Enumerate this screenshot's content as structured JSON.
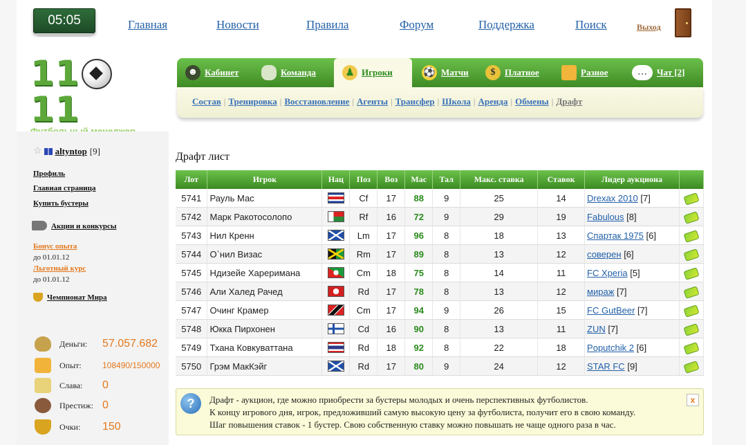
{
  "header": {
    "time": "05:05",
    "nav": [
      "Главная",
      "Новости",
      "Правила",
      "Форум",
      "Поддержка",
      "Поиск"
    ],
    "logout": "Выход"
  },
  "logo": {
    "digits_left": "11",
    "digits_right": "11",
    "subtitle": "Футбольный менеджер"
  },
  "tabs": [
    {
      "label": "Кабинет"
    },
    {
      "label": "Команда"
    },
    {
      "label": "Игроки"
    },
    {
      "label": "Матчи"
    },
    {
      "label": "Платное"
    },
    {
      "label": "Разное"
    },
    {
      "label": "Чат [2]"
    }
  ],
  "subnav": [
    "Состав",
    "Тренировка",
    "Восстановление",
    "Агенты",
    "Трансфер",
    "Школа",
    "Аренда",
    "Обмены",
    "Драфт"
  ],
  "sidebar": {
    "username": "altyntop",
    "level": "[9]",
    "links": [
      "Профиль",
      "Главная страница",
      "Купить бустеры"
    ],
    "promo": "Акции и конкурсы",
    "bonus1": "Бонус опыта",
    "bonus1_date": "до 01.01.12",
    "bonus2": "Льготный курс",
    "bonus2_date": "до 01.01.12",
    "championship": "Чемпионат Мира",
    "stats": {
      "money_label": "Деньги:",
      "money": "57.057.682",
      "exp_label": "Опыт:",
      "exp": "108490/150000",
      "fame_label": "Слава:",
      "fame": "0",
      "prestige_label": "Престиж:",
      "prestige": "0",
      "points_label": "Очки:",
      "points": "150"
    }
  },
  "content": {
    "title": "Драфт лист",
    "columns": [
      "Лот",
      "Игрок",
      "Нац",
      "Поз",
      "Воз",
      "Мас",
      "Тал",
      "Макс. ставка",
      "Ставок",
      "Лидер аукциона"
    ],
    "rows": [
      {
        "lot": "5741",
        "player": "Рауль Мас",
        "flag": "costa-rica",
        "pos": "Cf",
        "age": "17",
        "mas": "88",
        "tal": "9",
        "max_bid": "25",
        "bids": "14",
        "leader": "Drexax 2010",
        "leader_level": "[7]"
      },
      {
        "lot": "5742",
        "player": "Марк Ракотосолопо",
        "flag": "madagascar",
        "pos": "Rf",
        "age": "16",
        "mas": "72",
        "tal": "9",
        "max_bid": "29",
        "bids": "19",
        "leader": "Fabulous",
        "leader_level": "[8]"
      },
      {
        "lot": "5743",
        "player": "Нил Кренн",
        "flag": "scotland",
        "pos": "Lm",
        "age": "17",
        "mas": "96",
        "tal": "8",
        "max_bid": "18",
        "bids": "13",
        "leader": "Спартак 1975",
        "leader_level": "[6]"
      },
      {
        "lot": "5744",
        "player": "О`нил Визас",
        "flag": "jamaica",
        "pos": "Rm",
        "age": "17",
        "mas": "89",
        "tal": "8",
        "max_bid": "13",
        "bids": "12",
        "leader": "соверен",
        "leader_level": "[6]"
      },
      {
        "lot": "5745",
        "player": "Ндизейе Хареримана",
        "flag": "burundi",
        "pos": "Cm",
        "age": "18",
        "mas": "75",
        "tal": "8",
        "max_bid": "14",
        "bids": "11",
        "leader": "FC Xperia",
        "leader_level": "[5]"
      },
      {
        "lot": "5746",
        "player": "Али Халед Рачед",
        "flag": "tunisia",
        "pos": "Rd",
        "age": "17",
        "mas": "78",
        "tal": "8",
        "max_bid": "13",
        "bids": "12",
        "leader": "мираж",
        "leader_level": "[7]"
      },
      {
        "lot": "5747",
        "player": "Очинг Крамер",
        "flag": "trinidad",
        "pos": "Cm",
        "age": "17",
        "mas": "94",
        "tal": "9",
        "max_bid": "26",
        "bids": "15",
        "leader": "FC GutBeer",
        "leader_level": "[7]"
      },
      {
        "lot": "5748",
        "player": "Юкка Пирхонен",
        "flag": "finland",
        "pos": "Cd",
        "age": "16",
        "mas": "90",
        "tal": "8",
        "max_bid": "13",
        "bids": "11",
        "leader": "ZUN",
        "leader_level": "[7]"
      },
      {
        "lot": "5749",
        "player": "Тхана Ковкуваттана",
        "flag": "thailand",
        "pos": "Rd",
        "age": "18",
        "mas": "92",
        "tal": "8",
        "max_bid": "22",
        "bids": "18",
        "leader": "Poputchik 2",
        "leader_level": "[6]"
      },
      {
        "lot": "5750",
        "player": "Грэм МакКэйг",
        "flag": "scotland",
        "pos": "Rd",
        "age": "17",
        "mas": "80",
        "tal": "9",
        "max_bid": "24",
        "bids": "12",
        "leader": "STAR FC",
        "leader_level": "[9]"
      }
    ]
  },
  "info": {
    "icon": "?",
    "close": "x",
    "lines": [
      "Драфт - аукцион, где можно приобрести за бустеры молодых и очень перспективных футболистов.",
      "К концу игрового дня, игрок, предложивший самую высокую цену за футболиста, получит его в свою команду.",
      "Шаг повышения ставок - 1 бустер. Свою собственную ставку можно повышать не чаще одного раза в час."
    ]
  },
  "colors": {
    "green": "#4ea52f",
    "orange": "#e4781c",
    "link": "#2260a8"
  }
}
